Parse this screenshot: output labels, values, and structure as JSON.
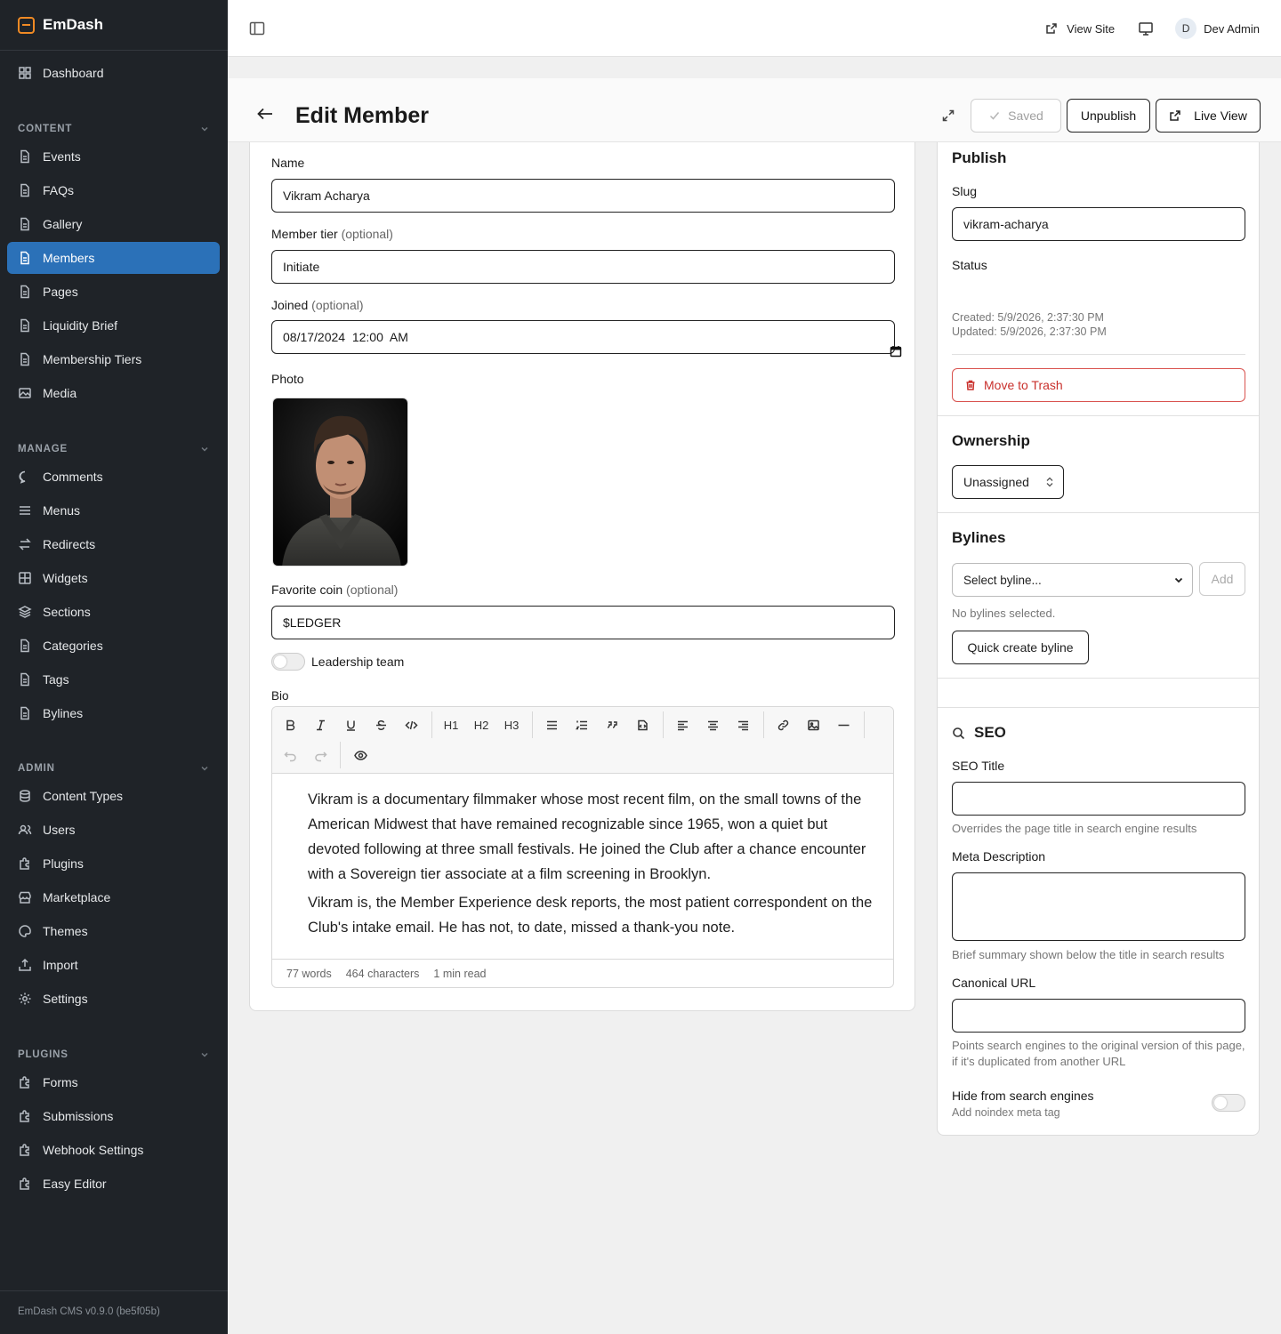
{
  "app": {
    "brand": "EmDash",
    "version": "EmDash CMS v0.9.0 (be5f05b)"
  },
  "sidebar": {
    "dashboard": "Dashboard",
    "sections": {
      "content": "CONTENT",
      "manage": "MANAGE",
      "admin": "ADMIN",
      "plugins": "PLUGINS"
    },
    "content_items": [
      "Events",
      "FAQs",
      "Gallery",
      "Members",
      "Pages",
      "Liquidity Brief",
      "Membership Tiers",
      "Media"
    ],
    "manage_items": [
      "Comments",
      "Menus",
      "Redirects",
      "Widgets",
      "Sections",
      "Categories",
      "Tags",
      "Bylines"
    ],
    "admin_items": [
      "Content Types",
      "Users",
      "Plugins",
      "Marketplace",
      "Themes",
      "Import",
      "Settings"
    ],
    "plugin_items": [
      "Forms",
      "Submissions",
      "Webhook Settings",
      "Easy Editor"
    ],
    "active_item": "Members"
  },
  "topbar": {
    "view_site": "View Site",
    "avatar_initial": "D",
    "user_name": "Dev Admin"
  },
  "header": {
    "title": "Edit Member",
    "saved": "Saved",
    "unpublish": "Unpublish",
    "live_view": "Live View"
  },
  "form": {
    "name_label": "Name",
    "name_value": "Vikram Acharya",
    "tier_label": "Member tier",
    "tier_opt": "(optional)",
    "tier_value": "Initiate",
    "joined_label": "Joined",
    "joined_opt": "(optional)",
    "joined_value": "08/17/2024  12:00  AM",
    "photo_label": "Photo",
    "coin_label": "Favorite coin",
    "coin_opt": "(optional)",
    "coin_value": "$LEDGER",
    "leadership_label": "Leadership team",
    "bio_label": "Bio",
    "bio_p1": "Vikram is a documentary filmmaker whose most recent film, on the small towns of the American Midwest that have remained recognizable since 1965, won a quiet but devoted following at three small festivals. He joined the Club after a chance encounter with a Sovereign tier associate at a film screening in Brooklyn.",
    "bio_p2": "Vikram is, the Member Experience desk reports, the most patient correspondent on the Club's intake email. He has not, to date, missed a thank-you note.",
    "words": "77 words",
    "characters": "464 characters",
    "read_time": "1 min read"
  },
  "toolbar": {
    "h1": "H1",
    "h2": "H2",
    "h3": "H3"
  },
  "publish": {
    "title": "Publish",
    "slug_label": "Slug",
    "slug_value": "vikram-acharya",
    "status_label": "Status",
    "created": "Created: 5/9/2026, 2:37:30 PM",
    "updated": "Updated: 5/9/2026, 2:37:30 PM",
    "trash": "Move to Trash"
  },
  "ownership": {
    "title": "Ownership",
    "value": "Unassigned"
  },
  "bylines": {
    "title": "Bylines",
    "select_placeholder": "Select byline...",
    "add": "Add",
    "empty": "No bylines selected.",
    "quick_create": "Quick create byline"
  },
  "seo": {
    "title": "SEO",
    "seo_title_label": "SEO Title",
    "seo_title_help": "Overrides the page title in search engine results",
    "meta_label": "Meta Description",
    "meta_help": "Brief summary shown below the title in search results",
    "canonical_label": "Canonical URL",
    "canonical_help": "Points search engines to the original version of this page, if it's duplicated from another URL",
    "hide_label": "Hide from search engines",
    "hide_help": "Add noindex meta tag"
  }
}
